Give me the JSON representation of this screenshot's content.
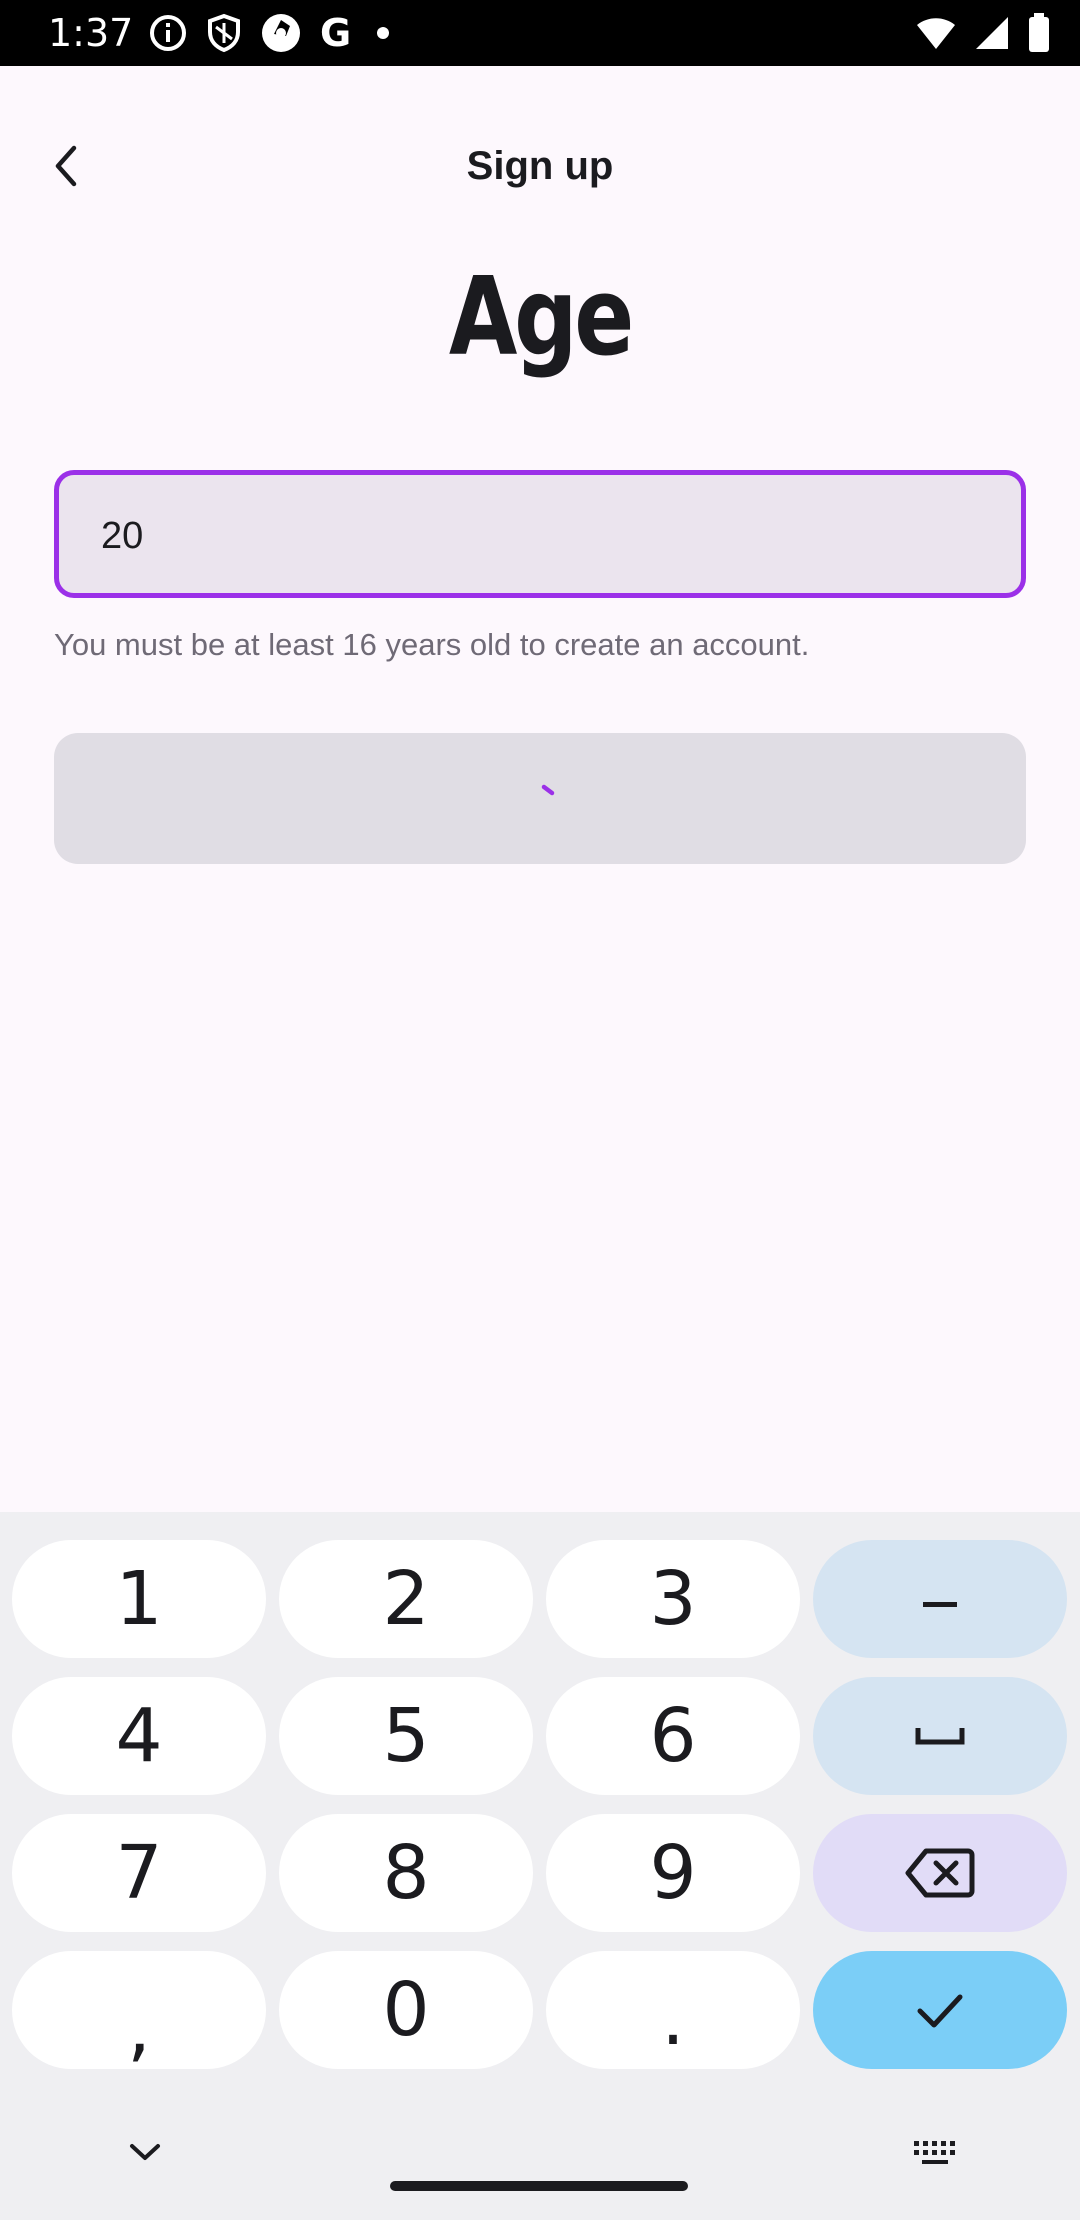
{
  "status_bar": {
    "time": "1:37",
    "icons_left": [
      "info-icon",
      "shield-icon",
      "shutter-app-icon",
      "google-icon",
      "notification-dot-icon"
    ],
    "google_glyph": "G",
    "icons_right": [
      "wifi-icon",
      "signal-icon",
      "battery-icon"
    ]
  },
  "header": {
    "title": "Sign up",
    "back_icon": "chevron-left-icon"
  },
  "main": {
    "heading": "Age",
    "age_input": {
      "value": "20",
      "accent_color": "#9b30e8"
    },
    "helper_text": "You must be at least 16 years old to create an account.",
    "continue_button": {
      "state": "loading",
      "spinner_color": "#9b30e8"
    }
  },
  "keyboard": {
    "rows": [
      [
        "1",
        "2",
        "3",
        "minus"
      ],
      [
        "4",
        "5",
        "6",
        "space"
      ],
      [
        "7",
        "8",
        "9",
        "backspace"
      ],
      [
        ",",
        "0",
        ".",
        "done"
      ]
    ],
    "keys": {
      "k1": "1",
      "k2": "2",
      "k3": "3",
      "minus": "–",
      "k4": "4",
      "k5": "5",
      "k6": "6",
      "k7": "7",
      "k8": "8",
      "k9": "9",
      "comma": ",",
      "k0": "0",
      "period": "."
    },
    "function_key_color": "#d5e4f2",
    "backspace_key_color": "#e1dcf7",
    "done_key_color": "#7bcef7"
  },
  "nav_bar": {
    "left": "chevron-down-icon",
    "right": "keyboard-icon"
  }
}
